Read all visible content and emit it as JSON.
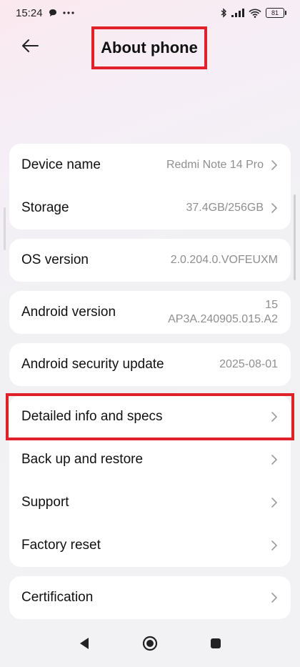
{
  "status_bar": {
    "time": "15:24",
    "battery": "81"
  },
  "header": {
    "title": "About phone"
  },
  "rows": [
    {
      "label": "Device name",
      "value": "Redmi Note 14 Pro"
    },
    {
      "label": "Storage",
      "value": "37.4GB/256GB"
    },
    {
      "label": "OS version",
      "value": "2.0.204.0.VOFEUXM"
    },
    {
      "label": "Android version",
      "value_line1": "15",
      "value_line2": "AP3A.240905.015.A2"
    },
    {
      "label": "Android security update",
      "value": "2025-08-01"
    },
    {
      "label": "Detailed info and specs"
    },
    {
      "label": "Back up and restore"
    },
    {
      "label": "Support"
    },
    {
      "label": "Factory reset"
    },
    {
      "label": "Certification"
    }
  ],
  "colors": {
    "highlight": "#e0202a",
    "value_text": "#8f8f8f",
    "card": "#ffffff"
  },
  "icons": [
    "back-arrow-icon",
    "chevron-right-icon",
    "nav-back-icon",
    "nav-home-icon",
    "nav-recents-icon"
  ]
}
